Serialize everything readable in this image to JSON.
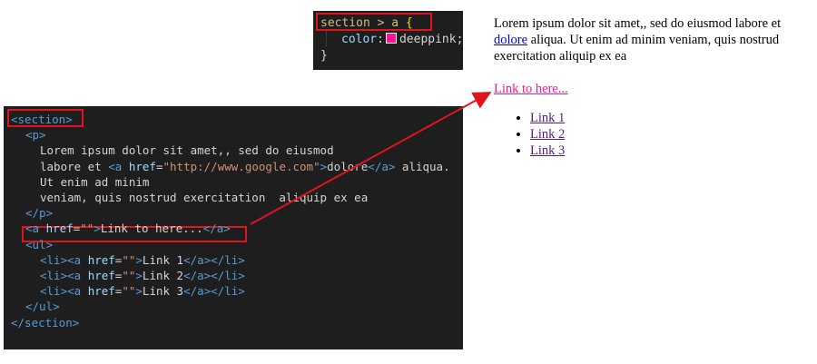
{
  "css_snippet": {
    "selector": "section > a",
    "brace_open": "{",
    "property": "color",
    "colon": ":",
    "value": "deeppink",
    "semicolon": ";",
    "brace_close": "}",
    "swatch_color": "#ff1493"
  },
  "html_code": {
    "lines": [
      "<section>",
      "<p>",
      "Lorem ipsum dolor sit amet,, sed do eiusmod",
      "labore et",
      "Ut enim ad minim",
      "veniam, quis nostrud exercitation  aliquip ex ea",
      "</p>",
      "Link to here...",
      "<ul>",
      "</ul>",
      "</section>"
    ],
    "link_line_href": "http://www.google.com",
    "link_line_text": "dolore",
    "link_line_after": " aliqua.",
    "list_items": [
      "Link 1",
      "Link 2",
      "Link 3"
    ]
  },
  "preview": {
    "paragraph_before": "Lorem ipsum dolor sit amet,, sed do eiusmod labore et ",
    "paragraph_link": "dolore",
    "paragraph_after": " aliqua. Ut enim ad minim veniam, quis nostrud exercitation aliquip ex ea",
    "section_link": "Link to here...",
    "list": [
      "Link 1",
      "Link 2",
      "Link 3"
    ]
  },
  "colors": {
    "highlight": "#e0141c",
    "deeppink": "#ff1493",
    "editor_bg": "#1e1e1e"
  }
}
